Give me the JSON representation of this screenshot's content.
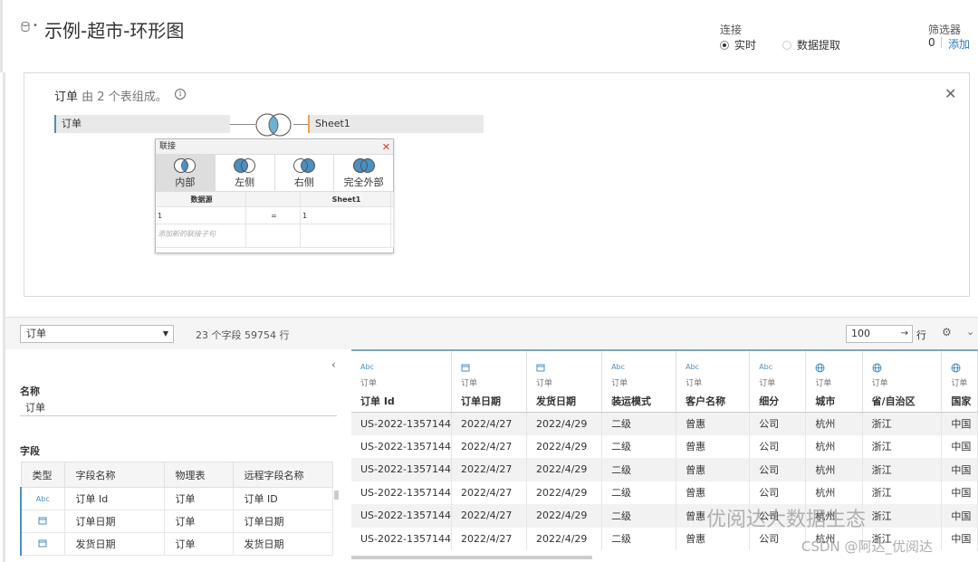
{
  "header": {
    "title": "示例-超市-环形图",
    "connection_label": "连接",
    "conn_live": "实时",
    "conn_extract": "数据提取",
    "filter_label": "筛选器",
    "filter_count": "0",
    "filter_add": "添加"
  },
  "canvas": {
    "title_main": "订单",
    "title_sub": "由 2 个表组成。",
    "left_table": "订单",
    "right_table": "Sheet1"
  },
  "join_popup": {
    "title": "联接",
    "types": [
      "内部",
      "左侧",
      "右侧",
      "完全外部"
    ],
    "col_left": "数据源",
    "col_right": "Sheet1",
    "clause_left": "1",
    "clause_op": "=",
    "clause_right": "1",
    "add_placeholder": "添加新的联接子句"
  },
  "toolbar": {
    "table_select": "订单",
    "info": "23 个字段 59754 行",
    "rows_value": "100",
    "rows_unit": "行"
  },
  "metadata": {
    "name_label": "名称",
    "name_value": "订单",
    "fields_label": "字段",
    "headers": [
      "类型",
      "字段名称",
      "物理表",
      "远程字段名称"
    ],
    "rows": [
      {
        "type": "Abc",
        "field": "订单 Id",
        "table": "订单",
        "remote": "订单 ID"
      },
      {
        "type": "date",
        "field": "订单日期",
        "table": "订单",
        "remote": "订单日期"
      },
      {
        "type": "date",
        "field": "发货日期",
        "table": "订单",
        "remote": "发货日期"
      }
    ]
  },
  "grid": {
    "columns": [
      {
        "icon": "Abc",
        "source": "订单",
        "name": "订单 Id"
      },
      {
        "icon": "date",
        "source": "订单",
        "name": "订单日期"
      },
      {
        "icon": "date",
        "source": "订单",
        "name": "发货日期"
      },
      {
        "icon": "Abc",
        "source": "订单",
        "name": "装运模式"
      },
      {
        "icon": "Abc",
        "source": "订单",
        "name": "客户名称"
      },
      {
        "icon": "Abc",
        "source": "订单",
        "name": "细分"
      },
      {
        "icon": "geo",
        "source": "订单",
        "name": "城市"
      },
      {
        "icon": "geo",
        "source": "订单",
        "name": "省/自治区"
      },
      {
        "icon": "geo",
        "source": "订单",
        "name": "国家"
      }
    ],
    "rows": [
      [
        "US-2022-1357144",
        "2022/4/27",
        "2022/4/29",
        "二级",
        "曾惠",
        "公司",
        "杭州",
        "浙江",
        "中国"
      ],
      [
        "US-2022-1357144",
        "2022/4/27",
        "2022/4/29",
        "二级",
        "曾惠",
        "公司",
        "杭州",
        "浙江",
        "中国"
      ],
      [
        "US-2022-1357144",
        "2022/4/27",
        "2022/4/29",
        "二级",
        "曾惠",
        "公司",
        "杭州",
        "浙江",
        "中国"
      ],
      [
        "US-2022-1357144",
        "2022/4/27",
        "2022/4/29",
        "二级",
        "曾惠",
        "公司",
        "杭州",
        "浙江",
        "中国"
      ],
      [
        "US-2022-1357144",
        "2022/4/27",
        "2022/4/29",
        "二级",
        "曾惠",
        "公司",
        "杭州",
        "浙江",
        "中国"
      ],
      [
        "US-2022-1357144",
        "2022/4/27",
        "2022/4/29",
        "二级",
        "曾惠",
        "公司",
        "杭州",
        "浙江",
        "中国"
      ]
    ]
  },
  "watermark": {
    "line1": "优阅达大数据生态",
    "line2": "CSDN @阿达_优阅达"
  },
  "colors": {
    "accent_blue": "#4a90c2",
    "link_blue": "#2b7bb9",
    "join_orange": "#f0a050"
  }
}
